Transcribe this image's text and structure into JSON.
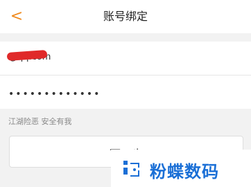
{
  "header": {
    "back_icon": "chevron-left-icon",
    "title": "账号绑定"
  },
  "form": {
    "account_value": "@qq.com",
    "password_value": "•••••••••••••"
  },
  "hint": "江湖险恶  安全有我",
  "next_button_label": "下一步",
  "watermark": {
    "text": "粉蝶数码",
    "color": "#1a6fd6"
  },
  "colors": {
    "accent": "#f08b1f",
    "background": "#f2f2f2"
  }
}
